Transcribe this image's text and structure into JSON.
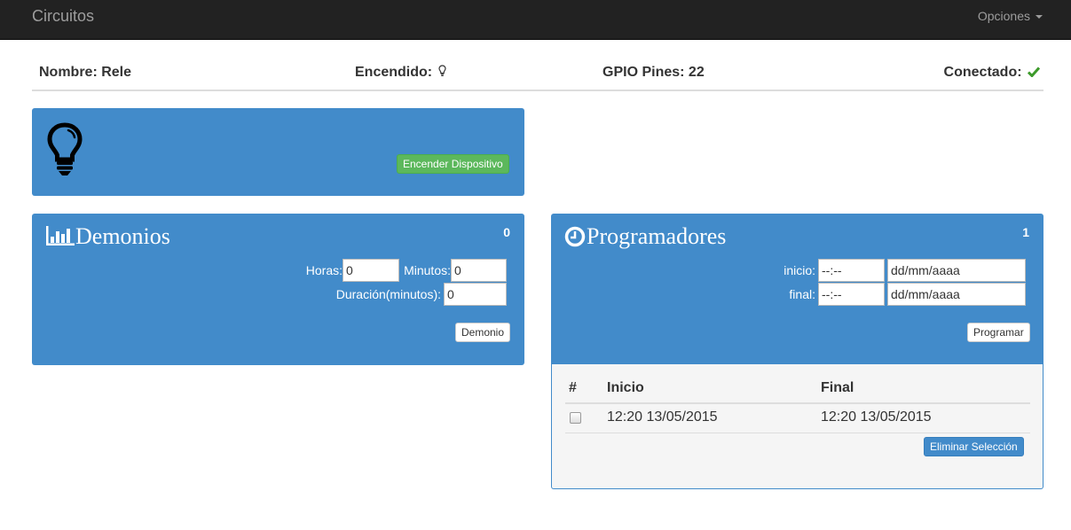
{
  "navbar": {
    "brand": "Circuitos",
    "options_label": "Opciones"
  },
  "info": {
    "name": "Nombre: Rele",
    "power_label": "Encendido:",
    "gpio": "GPIO Pines: 22",
    "connected_label": "Conectado:"
  },
  "device_panel": {
    "icon": "lightbulb-icon",
    "button_label": "Encender Dispositivo"
  },
  "demonios": {
    "icon": "bar-chart-icon",
    "title": "Demonios",
    "count": "0",
    "horas_label": "Horas:",
    "horas_value": "0",
    "minutos_label": "Minutos:",
    "minutos_value": "0",
    "duracion_label": "Duración(minutos):",
    "duracion_value": "0",
    "button_label": "Demonio"
  },
  "programadores": {
    "icon": "clock-icon",
    "title": "Programadores",
    "count": "1",
    "inicio_label": "inicio:",
    "inicio_time": "--:--",
    "inicio_date": "dd/mm/aaaa",
    "final_label": "final:",
    "final_time": "--:--",
    "final_date": "dd/mm/aaaa",
    "button_label": "Programar",
    "table": {
      "headers": [
        "#",
        "Inicio",
        "Final"
      ],
      "rows": [
        {
          "inicio": "12:20 13/05/2015",
          "final": "12:20 13/05/2015",
          "checked": false
        }
      ]
    },
    "delete_label": "Eliminar Selección"
  },
  "colors": {
    "panel_blue": "#428bca",
    "success_green": "#5cb85c",
    "check_green": "#3c9a2a",
    "navbar_dark": "#222222"
  }
}
